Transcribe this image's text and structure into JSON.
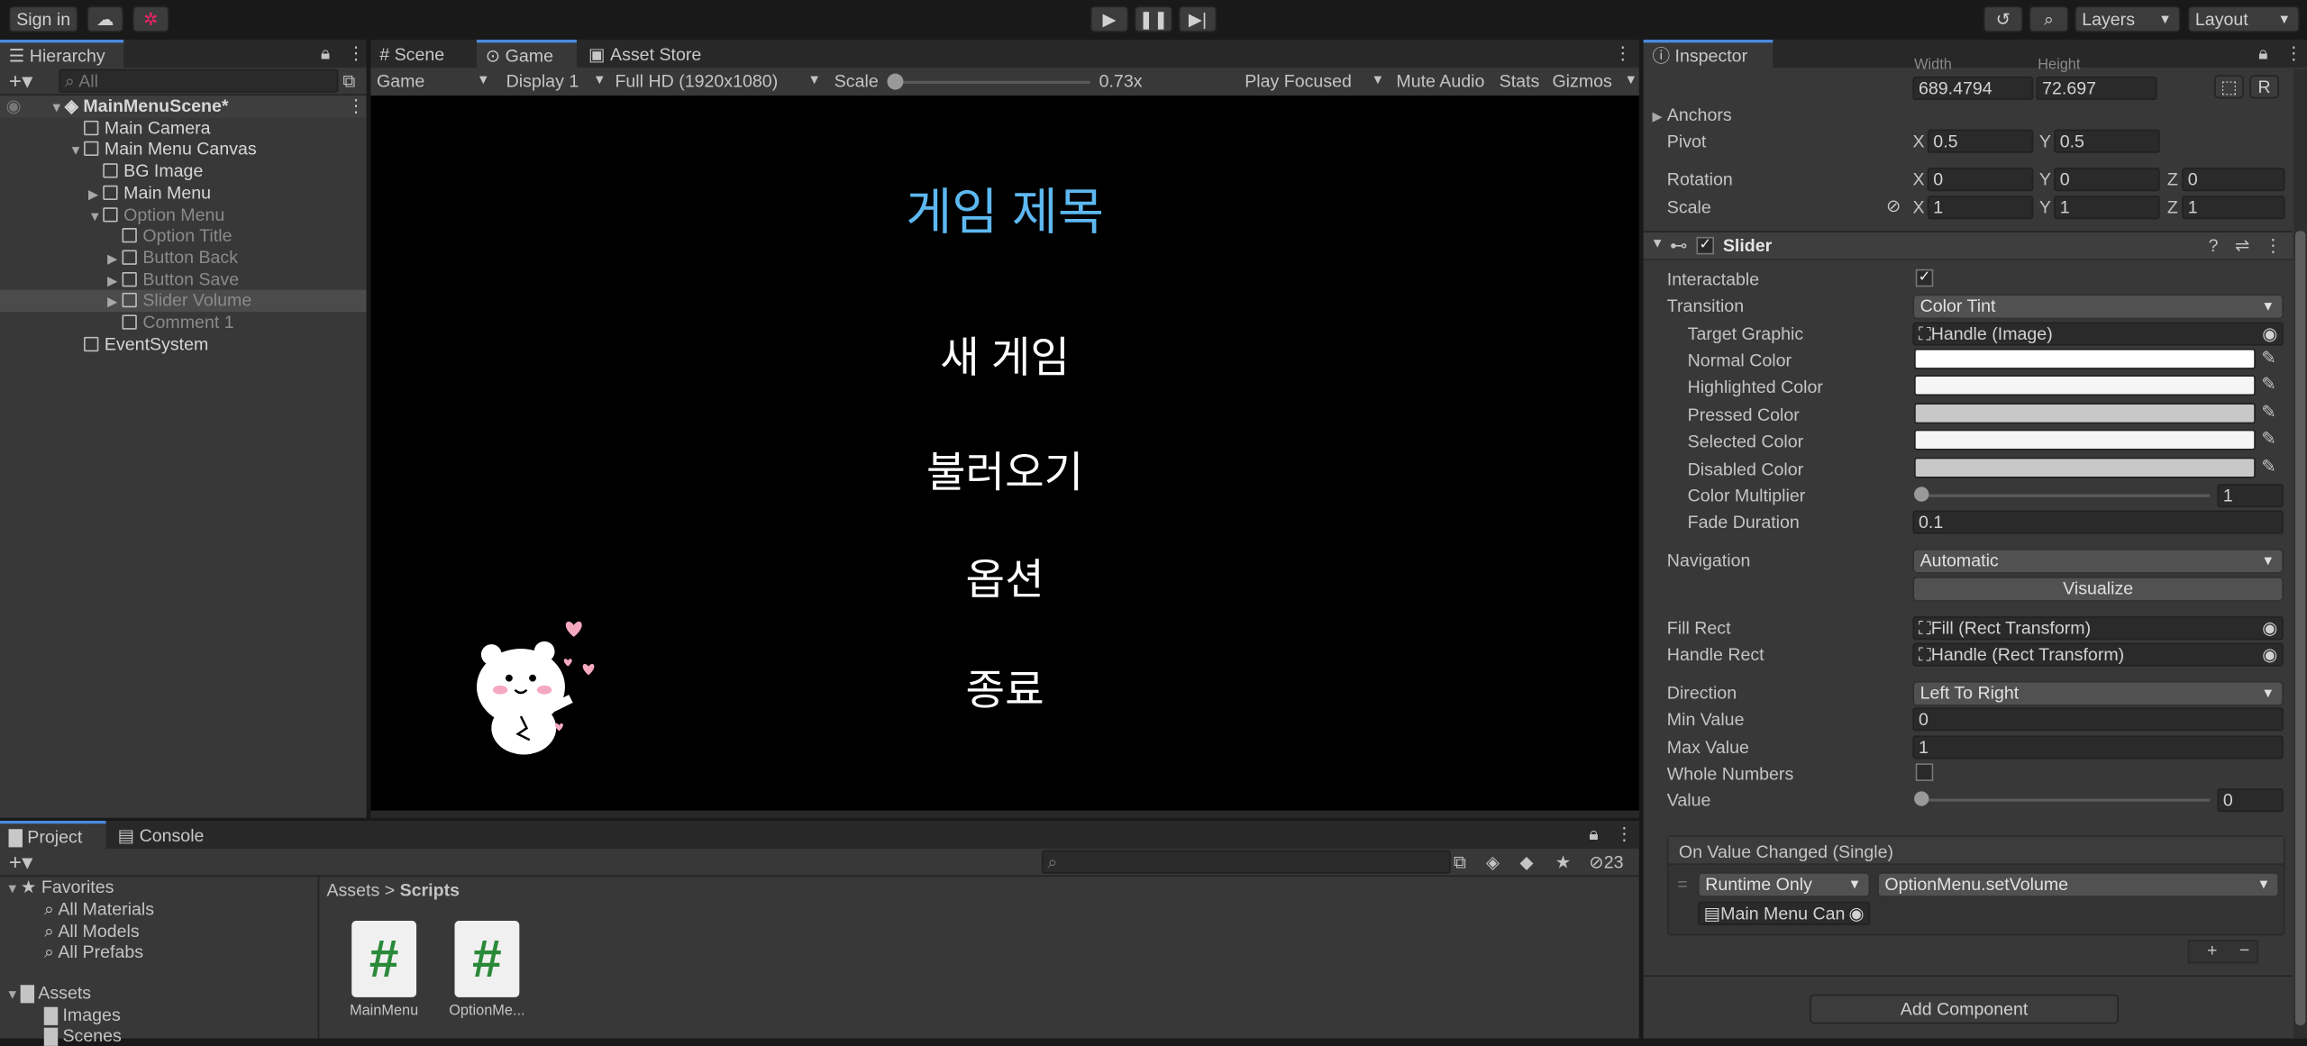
{
  "topbar": {
    "sign_in": "Sign in",
    "layers": "Layers",
    "layout": "Layout"
  },
  "hierarchy": {
    "tab": "Hierarchy",
    "search_placeholder": "All",
    "items": [
      {
        "label": "MainMenuScene*",
        "bold": true
      },
      {
        "label": "Main Camera"
      },
      {
        "label": "Main Menu Canvas"
      },
      {
        "label": "BG Image"
      },
      {
        "label": "Main Menu"
      },
      {
        "label": "Option Menu"
      },
      {
        "label": "Option Title"
      },
      {
        "label": "Button Back"
      },
      {
        "label": "Button Save"
      },
      {
        "label": "Slider Volume"
      },
      {
        "label": "Comment 1"
      },
      {
        "label": "EventSystem"
      }
    ]
  },
  "viewport": {
    "tabs": [
      "Scene",
      "Game",
      "Asset Store"
    ],
    "toolbar": {
      "mode": "Game",
      "display": "Display 1",
      "resolution": "Full HD (1920x1080)",
      "scale_label": "Scale",
      "scale_value": "0.73x",
      "play_focused": "Play Focused",
      "mute": "Mute Audio",
      "stats": "Stats",
      "gizmos": "Gizmos"
    },
    "game": {
      "title": "게임 제목",
      "menu": [
        "새 게임",
        "불러오기",
        "옵션",
        "종료"
      ],
      "title_color": "#5db8f0"
    }
  },
  "project": {
    "tabs": [
      "Project",
      "Console"
    ],
    "hidden_count": "23",
    "favorites_label": "Favorites",
    "favorites": [
      "All Materials",
      "All Models",
      "All Prefabs"
    ],
    "assets_label": "Assets",
    "assets_children": [
      "Images",
      "Scenes"
    ],
    "breadcrumb": [
      "Assets",
      "Scripts"
    ],
    "files": [
      "MainMenu",
      "OptionMe..."
    ]
  },
  "inspector": {
    "tab": "Inspector",
    "width_label": "Width",
    "height_label": "Height",
    "width": "689.4794",
    "height": "72.697",
    "r_button": "R",
    "anchors": "Anchors",
    "pivot_label": "Pivot",
    "pivot": {
      "x": "0.5",
      "y": "0.5"
    },
    "rotation_label": "Rotation",
    "rotation": {
      "x": "0",
      "y": "0",
      "z": "0"
    },
    "scale_label": "Scale",
    "scale": {
      "x": "1",
      "y": "1",
      "z": "1"
    },
    "axis": {
      "x": "X",
      "y": "Y",
      "z": "Z"
    },
    "component": "Slider",
    "interactable_label": "Interactable",
    "transition_label": "Transition",
    "transition": "Color Tint",
    "target_graphic_label": "Target Graphic",
    "target_graphic": "Handle (Image)",
    "normal_color_label": "Normal Color",
    "highlighted_color_label": "Highlighted Color",
    "pressed_color_label": "Pressed Color",
    "selected_color_label": "Selected Color",
    "disabled_color_label": "Disabled Color",
    "color_multiplier_label": "Color Multiplier",
    "color_multiplier": "1",
    "fade_duration_label": "Fade Duration",
    "fade_duration": "0.1",
    "navigation_label": "Navigation",
    "navigation": "Automatic",
    "visualize": "Visualize",
    "fill_rect_label": "Fill Rect",
    "fill_rect": "Fill (Rect Transform)",
    "handle_rect_label": "Handle Rect",
    "handle_rect": "Handle (Rect Transform)",
    "direction_label": "Direction",
    "direction": "Left To Right",
    "min_value_label": "Min Value",
    "min_value": "0",
    "max_value_label": "Max Value",
    "max_value": "1",
    "whole_numbers_label": "Whole Numbers",
    "value_label": "Value",
    "value": "0",
    "event_label": "On Value Changed (Single)",
    "runtime": "Runtime Only",
    "function": "OptionMenu.setVolume",
    "object": "Main Menu Can",
    "add_component": "Add Component",
    "colors": {
      "normal": "#ffffff",
      "highlighted": "#f5f5f5",
      "pressed": "#c8c8c8",
      "selected": "#f5f5f5",
      "disabled": "#c8c8c8"
    }
  }
}
